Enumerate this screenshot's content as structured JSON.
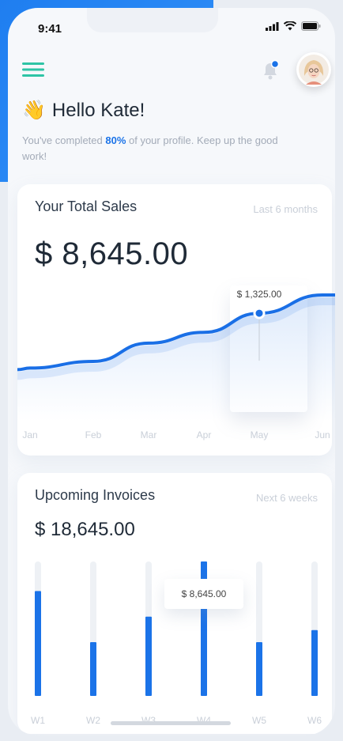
{
  "status_bar": {
    "time": "9:41"
  },
  "header": {
    "greeting_emoji": "👋",
    "greeting": "Hello Kate!",
    "profile_prefix": "You've completed ",
    "profile_percent": "80%",
    "profile_suffix": " of your profile. Keep up the good work!",
    "has_notification": true
  },
  "sales": {
    "title": "Your Total Sales",
    "range": "Last 6 months",
    "amount": "$ 8,645.00",
    "highlight_label": "$ 1,325.00",
    "highlight_month": "May"
  },
  "invoices": {
    "title": "Upcoming Invoices",
    "range": "Next 6 weeks",
    "amount": "$ 18,645.00",
    "highlight_label": "$ 8,645.00",
    "highlight_week": "W4"
  },
  "chart_data": [
    {
      "type": "line",
      "title": "Your Total Sales",
      "x": [
        "Jan",
        "Feb",
        "Mar",
        "Apr",
        "May",
        "Jun"
      ],
      "series": [
        {
          "values": [
            0.12,
            0.2,
            0.42,
            0.55,
            0.78,
            1.0
          ]
        }
      ],
      "annotations": [
        {
          "x": "May",
          "label": "$ 1,325.00"
        }
      ],
      "grid": false
    },
    {
      "type": "bar",
      "title": "Upcoming Invoices",
      "categories": [
        "W1",
        "W2",
        "W3",
        "W4",
        "W5",
        "W6"
      ],
      "values": [
        0.78,
        0.4,
        0.59,
        1.0,
        0.4,
        0.49
      ],
      "ylim": [
        0,
        1
      ],
      "annotations": [
        {
          "x": "W4",
          "label": "$ 8,645.00"
        }
      ]
    }
  ],
  "colors": {
    "accent": "#1b73e8",
    "line": "#1a6fe6",
    "menu": "#2ec4a5",
    "track": "#eef1f5",
    "muted_text": "#c9cfd8"
  },
  "icons": {
    "menu": "hamburger-icon",
    "bell": "bell-icon",
    "signal": "signal-icon",
    "wifi": "wifi-icon",
    "battery": "battery-icon"
  }
}
